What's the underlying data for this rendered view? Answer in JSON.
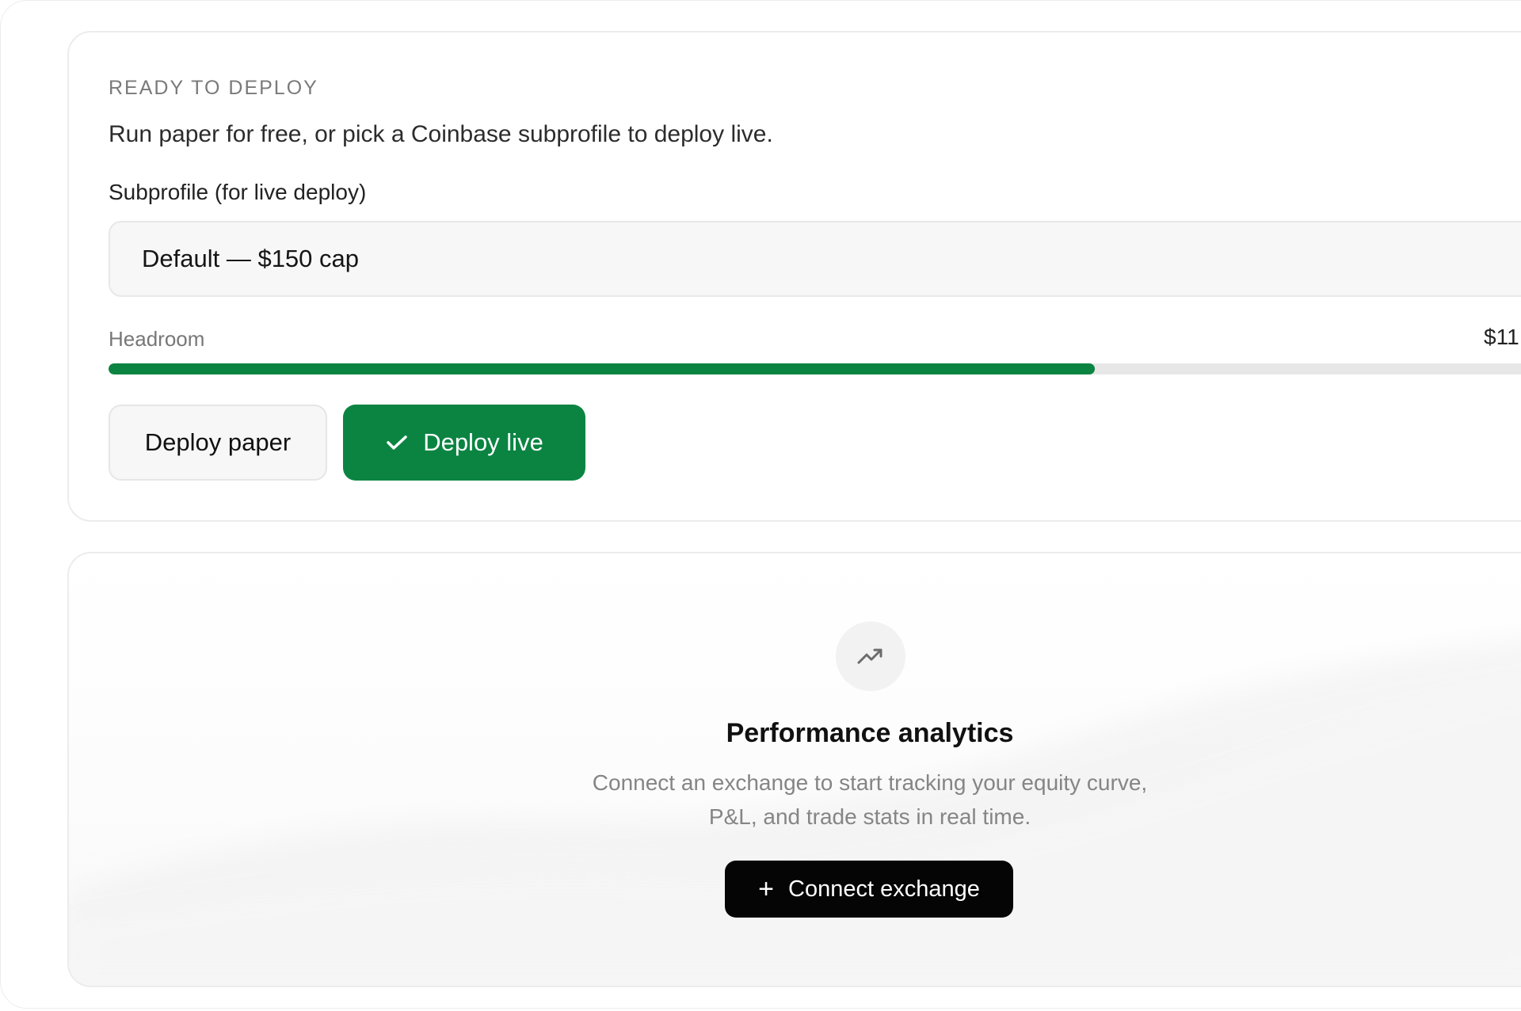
{
  "deploy": {
    "eyebrow": "READY TO DEPLOY",
    "intro": "Run paper for free, or pick a Coinbase subprofile to deploy live.",
    "subprofile_label": "Subprofile (for live deploy)",
    "subprofile_selected": "Default — $150 cap",
    "headroom_label": "Headroom",
    "headroom_value": "$11",
    "headroom_fraction": 0.655,
    "paper_button_label": "Deploy paper",
    "live_button_label": "Deploy live",
    "live_button_icon": "check-icon",
    "accent_color": "#0b8442"
  },
  "analytics": {
    "icon": "trending-up-icon",
    "title": "Performance analytics",
    "description_line1": "Connect an exchange to start tracking your equity curve,",
    "description_line2": "P&L, and trade stats in real time.",
    "connect_button_label": "Connect exchange",
    "connect_button_icon": "plus-icon"
  }
}
